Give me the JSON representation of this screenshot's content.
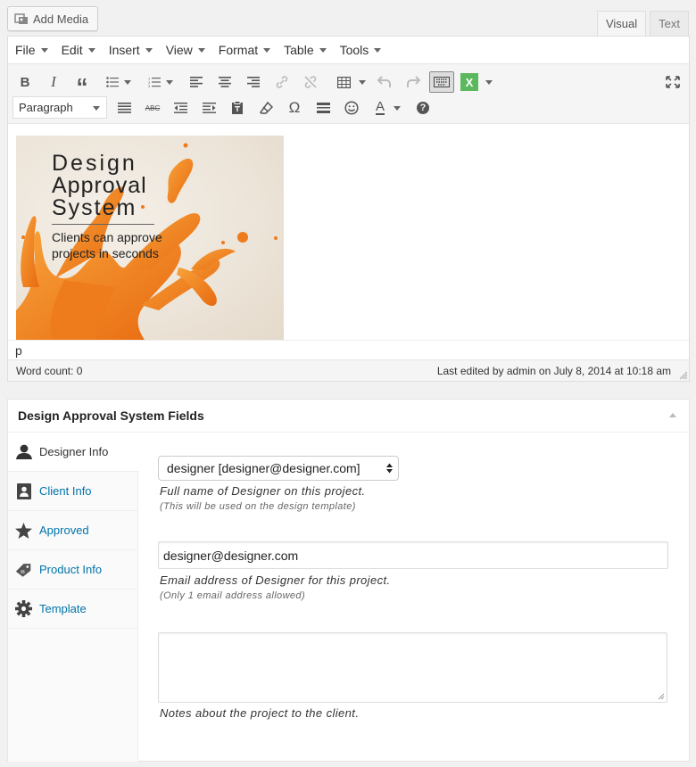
{
  "media": {
    "add_media_label": "Add Media"
  },
  "editor_tabs": [
    {
      "label": "Visual",
      "active": true
    },
    {
      "label": "Text",
      "active": false
    }
  ],
  "menubar": [
    {
      "label": "File"
    },
    {
      "label": "Edit"
    },
    {
      "label": "Insert"
    },
    {
      "label": "View"
    },
    {
      "label": "Format"
    },
    {
      "label": "Table"
    },
    {
      "label": "Tools"
    }
  ],
  "toolbar": {
    "format_select_value": "Paragraph",
    "row1_icons": [
      "bold-icon",
      "italic-icon",
      "blockquote-icon",
      "bullet-list-icon",
      "numbered-list-icon",
      "align-left-icon",
      "align-center-icon",
      "align-right-icon",
      "link-icon",
      "unlink-icon",
      "table-icon",
      "undo-icon",
      "redo-icon",
      "toolbar-toggle-icon",
      "excel-icon",
      "fullscreen-icon"
    ],
    "row2_icons": [
      "justify-icon",
      "strikethrough-icon",
      "outdent-icon",
      "indent-icon",
      "paste-text-icon",
      "clear-format-icon",
      "special-char-icon",
      "horizontal-rule-icon",
      "emoticon-icon",
      "text-color-icon",
      "help-icon"
    ],
    "bold_glyph": "B",
    "italic_glyph": "I",
    "quote_glyph": "“",
    "excel_glyph": "X",
    "omega_glyph": "Ω",
    "abc_glyph": "ABC",
    "color_glyph": "A",
    "help_glyph": "?"
  },
  "content": {
    "image_line1": "Design",
    "image_line2": "Approval",
    "image_line3": "System",
    "image_sub1": "Clients can approve",
    "image_sub2": "projects in seconds",
    "path": "p"
  },
  "status": {
    "word_count": "Word count: 0",
    "last_edited": "Last edited by admin on July 8, 2014 at 10:18 am"
  },
  "metabox": {
    "title": "Design Approval System Fields",
    "tabs": [
      {
        "label": "Designer Info",
        "icon": "user-icon",
        "active": true
      },
      {
        "label": "Client Info",
        "icon": "id-card-icon",
        "active": false
      },
      {
        "label": "Approved",
        "icon": "star-icon",
        "active": false
      },
      {
        "label": "Product Info",
        "icon": "price-tag-icon",
        "active": false
      },
      {
        "label": "Template",
        "icon": "gear-icon",
        "active": false
      }
    ],
    "designer_select_value": "designer [designer@designer.com]",
    "designer_desc": "Full name of Designer on this project.",
    "designer_note": "(This will be used on the design template)",
    "email_value": "designer@designer.com",
    "email_desc": "Email address of Designer for this project.",
    "email_note": "(Only 1 email address allowed)",
    "notes_value": "",
    "notes_desc": "Notes about the project to the client."
  }
}
